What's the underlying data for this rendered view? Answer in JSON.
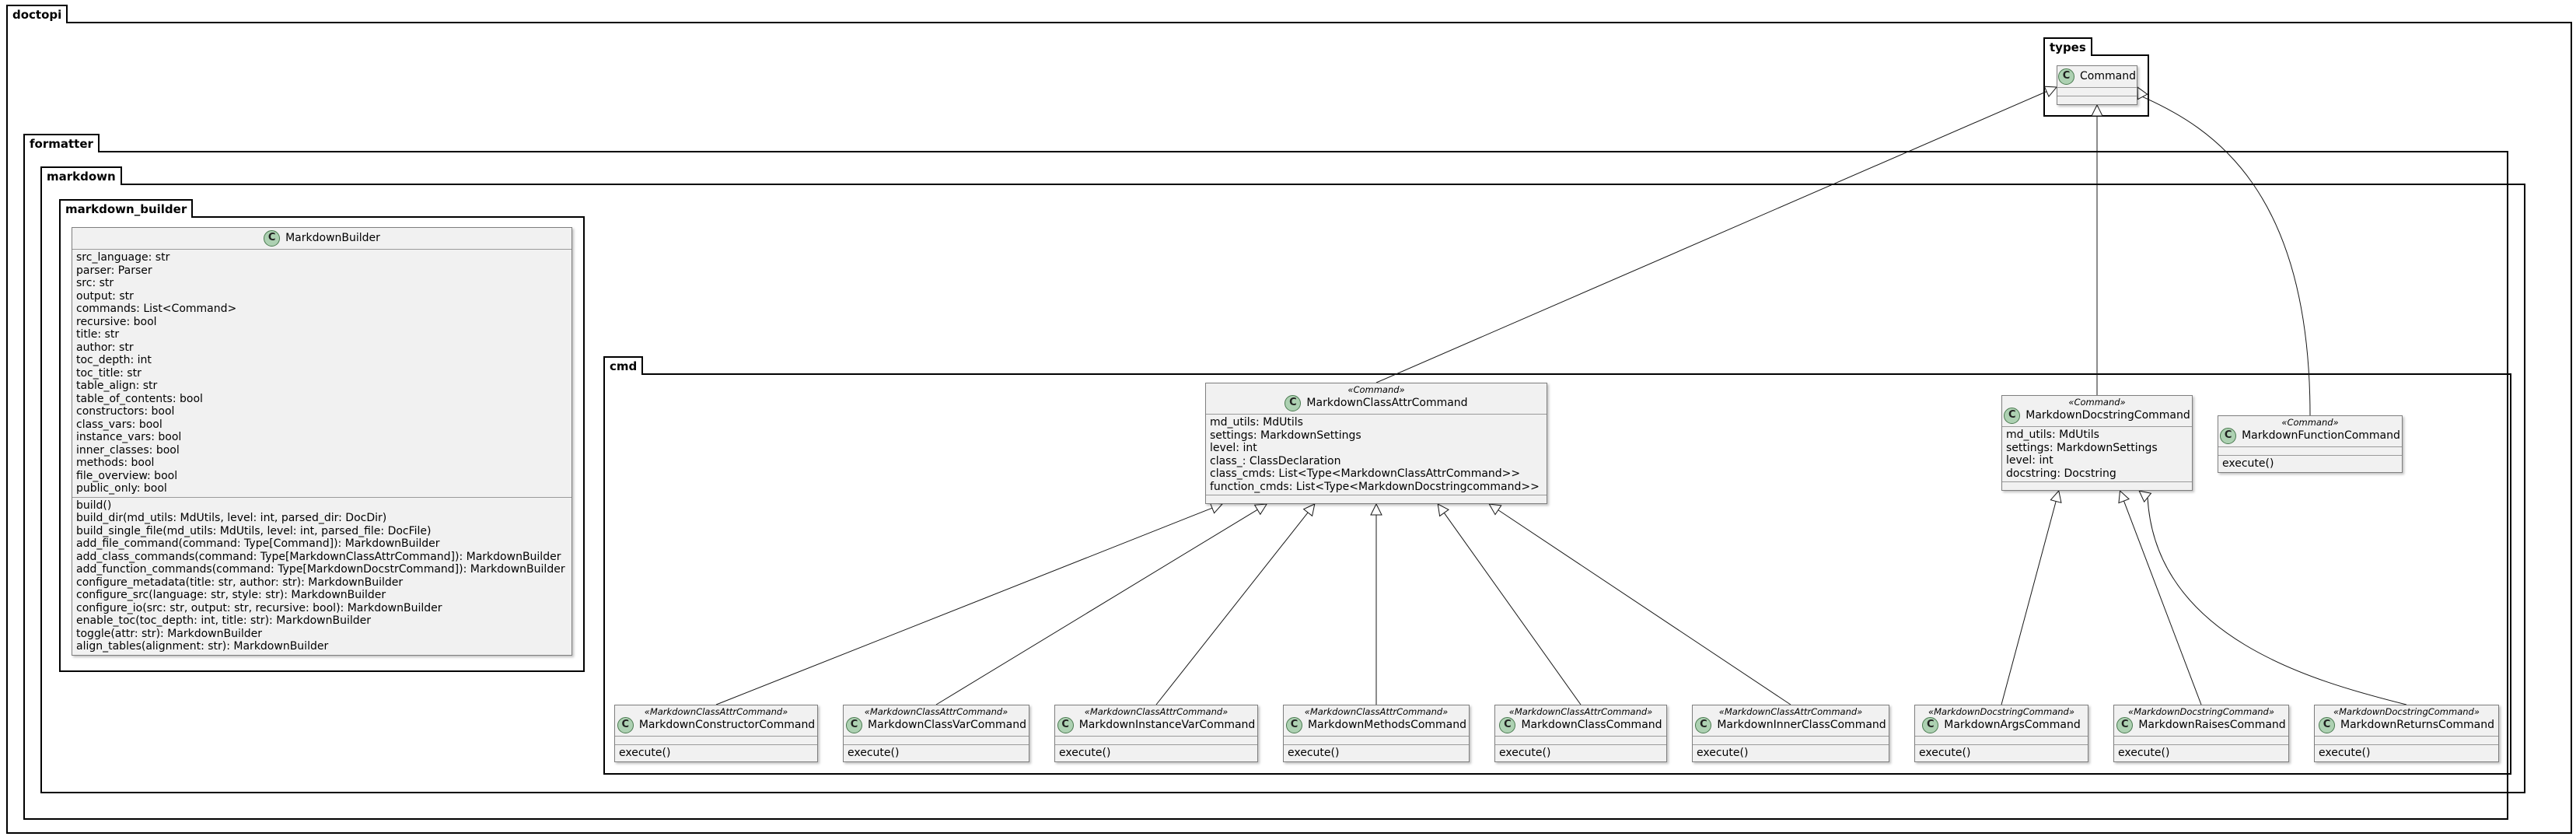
{
  "packages": {
    "doctopi": "doctopi",
    "types": "types",
    "formatter": "formatter",
    "markdown": "markdown",
    "markdown_builder": "markdown_builder",
    "cmd": "cmd"
  },
  "classes": {
    "command": {
      "name": "Command",
      "stereotype": "",
      "fields": [],
      "methods": []
    },
    "markdown_builder": {
      "name": "MarkdownBuilder",
      "stereotype": "",
      "fields": [
        "src_language: str",
        "parser: Parser",
        "src: str",
        "output: str",
        "commands: List<Command>",
        "recursive: bool",
        "title: str",
        "author: str",
        "toc_depth: int",
        "toc_title: str",
        "table_align: str",
        "table_of_contents: bool",
        "constructors: bool",
        "class_vars: bool",
        "instance_vars: bool",
        "inner_classes: bool",
        "methods: bool",
        "file_overview: bool",
        "public_only: bool"
      ],
      "methods": [
        "build()",
        "build_dir(md_utils: MdUtils, level: int, parsed_dir: DocDir)",
        "build_single_file(md_utils: MdUtils, level: int, parsed_file: DocFile)",
        "add_file_command(command: Type[Command]): MarkdownBuilder",
        "add_class_commands(command: Type[MarkdownClassAttrCommand]): MarkdownBuilder",
        "add_function_commands(command: Type[MarkdownDocstrCommand]): MarkdownBuilder",
        "configure_metadata(title: str, author: str): MarkdownBuilder",
        "configure_src(language: str, style: str): MarkdownBuilder",
        "configure_io(src: str, output: str, recursive: bool): MarkdownBuilder",
        "enable_toc(toc_depth: int, title: str): MarkdownBuilder",
        "toggle(attr: str): MarkdownBuilder",
        "align_tables(alignment: str): MarkdownBuilder"
      ]
    },
    "class_attr": {
      "name": "MarkdownClassAttrCommand",
      "stereotype": "«Command»",
      "fields": [
        "md_utils: MdUtils",
        "settings: MarkdownSettings",
        "level: int",
        "class_: ClassDeclaration",
        "class_cmds: List<Type<MarkdownClassAttrCommand>>",
        "function_cmds: List<Type<MarkdownDocstringcommand>>"
      ],
      "methods": []
    },
    "docstring": {
      "name": "MarkdownDocstringCommand",
      "stereotype": "«Command»",
      "fields": [
        "md_utils: MdUtils",
        "settings: MarkdownSettings",
        "level: int",
        "docstring: Docstring"
      ],
      "methods": []
    },
    "function": {
      "name": "MarkdownFunctionCommand",
      "stereotype": "«Command»",
      "fields": [],
      "methods": [
        "execute()"
      ]
    },
    "constructor": {
      "name": "MarkdownConstructorCommand",
      "stereotype": "«MarkdownClassAttrCommand»",
      "fields": [],
      "methods": [
        "execute()"
      ]
    },
    "class_var": {
      "name": "MarkdownClassVarCommand",
      "stereotype": "«MarkdownClassAttrCommand»",
      "fields": [],
      "methods": [
        "execute()"
      ]
    },
    "instance_var": {
      "name": "MarkdownInstanceVarCommand",
      "stereotype": "«MarkdownClassAttrCommand»",
      "fields": [],
      "methods": [
        "execute()"
      ]
    },
    "methods_cmd": {
      "name": "MarkdownMethodsCommand",
      "stereotype": "«MarkdownClassAttrCommand»",
      "fields": [],
      "methods": [
        "execute()"
      ]
    },
    "class_cmd": {
      "name": "MarkdownClassCommand",
      "stereotype": "«MarkdownClassAttrCommand»",
      "fields": [],
      "methods": [
        "execute()"
      ]
    },
    "inner_class": {
      "name": "MarkdownInnerClassCommand",
      "stereotype": "«MarkdownClassAttrCommand»",
      "fields": [],
      "methods": [
        "execute()"
      ]
    },
    "args": {
      "name": "MarkdownArgsCommand",
      "stereotype": "«MarkdownDocstringCommand»",
      "fields": [],
      "methods": [
        "execute()"
      ]
    },
    "raises": {
      "name": "MarkdownRaisesCommand",
      "stereotype": "«MarkdownDocstringCommand»",
      "fields": [],
      "methods": [
        "execute()"
      ]
    },
    "returns": {
      "name": "MarkdownReturnsCommand",
      "stereotype": "«MarkdownDocstringCommand»",
      "fields": [],
      "methods": [
        "execute()"
      ]
    }
  },
  "class_icon_letter": "C",
  "inheritance": [
    {
      "child": "class_attr",
      "parent": "command"
    },
    {
      "child": "docstring",
      "parent": "command"
    },
    {
      "child": "function",
      "parent": "command"
    },
    {
      "child": "constructor",
      "parent": "class_attr"
    },
    {
      "child": "class_var",
      "parent": "class_attr"
    },
    {
      "child": "instance_var",
      "parent": "class_attr"
    },
    {
      "child": "methods_cmd",
      "parent": "class_attr"
    },
    {
      "child": "class_cmd",
      "parent": "class_attr"
    },
    {
      "child": "inner_class",
      "parent": "class_attr"
    },
    {
      "child": "args",
      "parent": "docstring"
    },
    {
      "child": "raises",
      "parent": "docstring"
    },
    {
      "child": "returns",
      "parent": "docstring"
    }
  ]
}
